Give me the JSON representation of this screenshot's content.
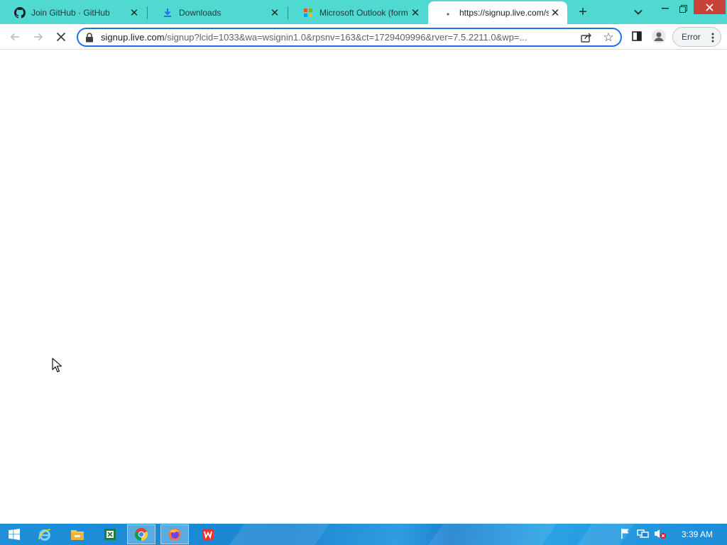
{
  "browser": {
    "tabs": [
      {
        "title": "Join GitHub · GitHub",
        "icon": "github-icon",
        "active": false
      },
      {
        "title": "Downloads",
        "icon": "download-icon",
        "active": false
      },
      {
        "title": "Microsoft Outlook (form",
        "icon": "outlook-loading-icon",
        "active": false
      },
      {
        "title": "https://signup.live.com/s",
        "icon": "loading-spinner-icon",
        "active": true
      }
    ],
    "close_glyph": "✕",
    "new_tab_glyph": "+",
    "address_bar": {
      "host": "signup.live.com",
      "path": "/signup?lcid=1033&wa=wsignin1.0&rpsnv=163&ct=1729409996&rver=7.5.2211.0&wp=..."
    },
    "error_button_label": "Error",
    "colors": {
      "tab_strip": "#4fd9d1",
      "focus_ring": "#1a73e8",
      "close_hover": "#c8423a"
    }
  },
  "taskbar": {
    "apps": [
      "start-icon",
      "internet-explorer-icon",
      "file-explorer-icon",
      "excel-icon",
      "chrome-icon",
      "firefox-icon",
      "wps-office-icon"
    ],
    "clock": "3:39 AM"
  }
}
